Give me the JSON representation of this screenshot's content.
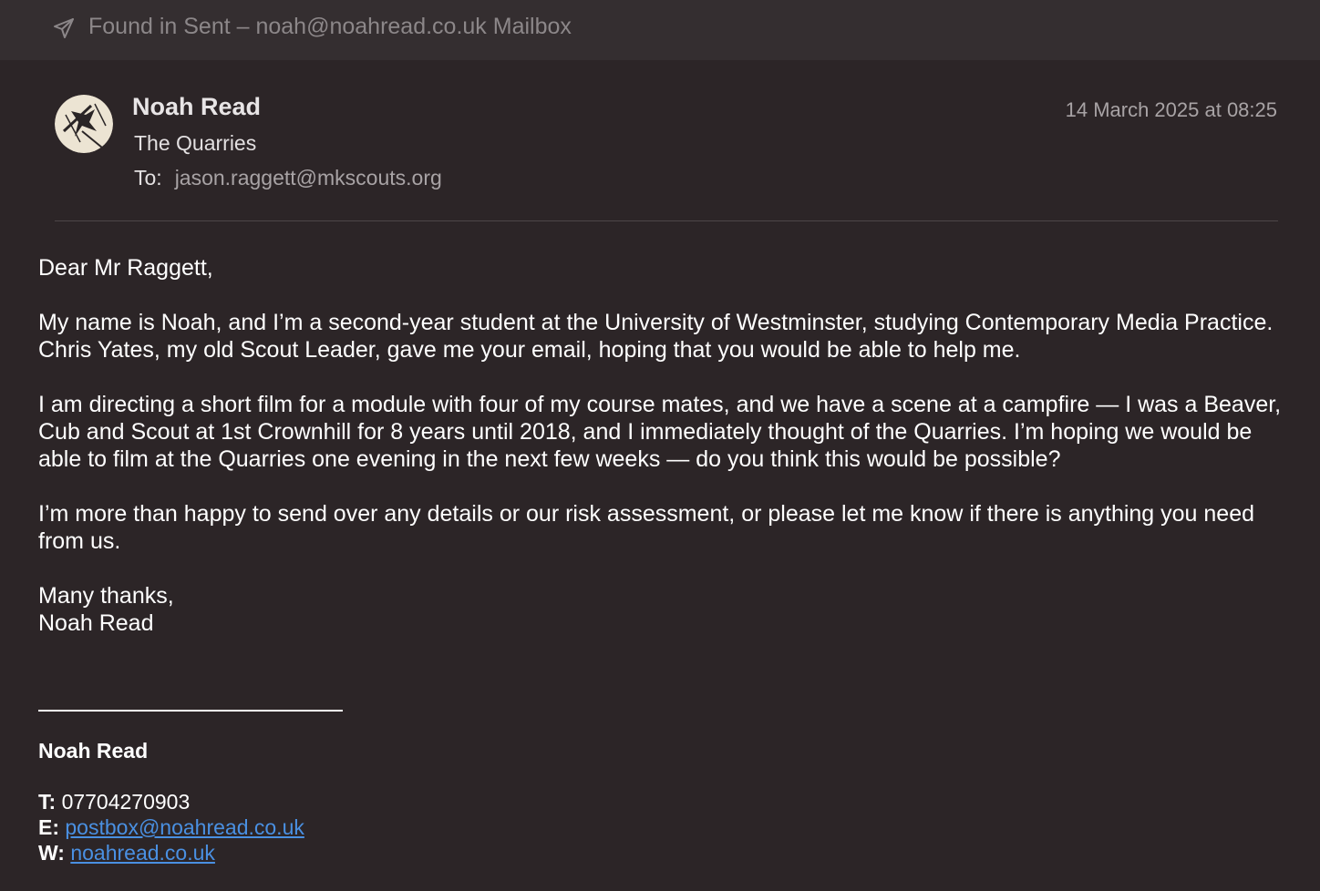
{
  "banner": {
    "icon": "paper-plane-icon",
    "text": "Found in Sent – noah@noahread.co.uk Mailbox"
  },
  "header": {
    "sender_name": "Noah Read",
    "subject": "The Quarries",
    "to_label": "To:",
    "to_address": "jason.raggett@mkscouts.org",
    "date": "14 March 2025 at 08:25"
  },
  "body": {
    "greeting": "Dear Mr Raggett,",
    "paragraphs": [
      "My name is Noah, and I’m a second-year student at the University of Westminster, studying Contemporary Media Practice. Chris Yates, my old Scout Leader, gave me your email, hoping that you would be able to help me.",
      "I am directing a short film for a module with four of my course mates, and we have a scene at a campfire — I was a Beaver, Cub and Scout at 1st Crownhill for 8 years until 2018, and I immediately thought of the Quarries. I’m hoping we would be able to film at the Quarries one evening in the next few weeks — do you think this would be possible?",
      "I’m more than happy to send over any details or our risk assessment, or please let me know if there is anything you need from us."
    ],
    "signoff": "Many thanks,",
    "signoff_name": "Noah Read"
  },
  "signature": {
    "name": "Noah Read",
    "phone_label": "T:",
    "phone": "07704270903",
    "email_label": "E:",
    "email": "postbox@noahread.co.uk",
    "web_label": "W:",
    "web": "noahread.co.uk"
  },
  "colors": {
    "background": "#2c2527",
    "banner_background": "#342e30",
    "link": "#4a90e2"
  }
}
